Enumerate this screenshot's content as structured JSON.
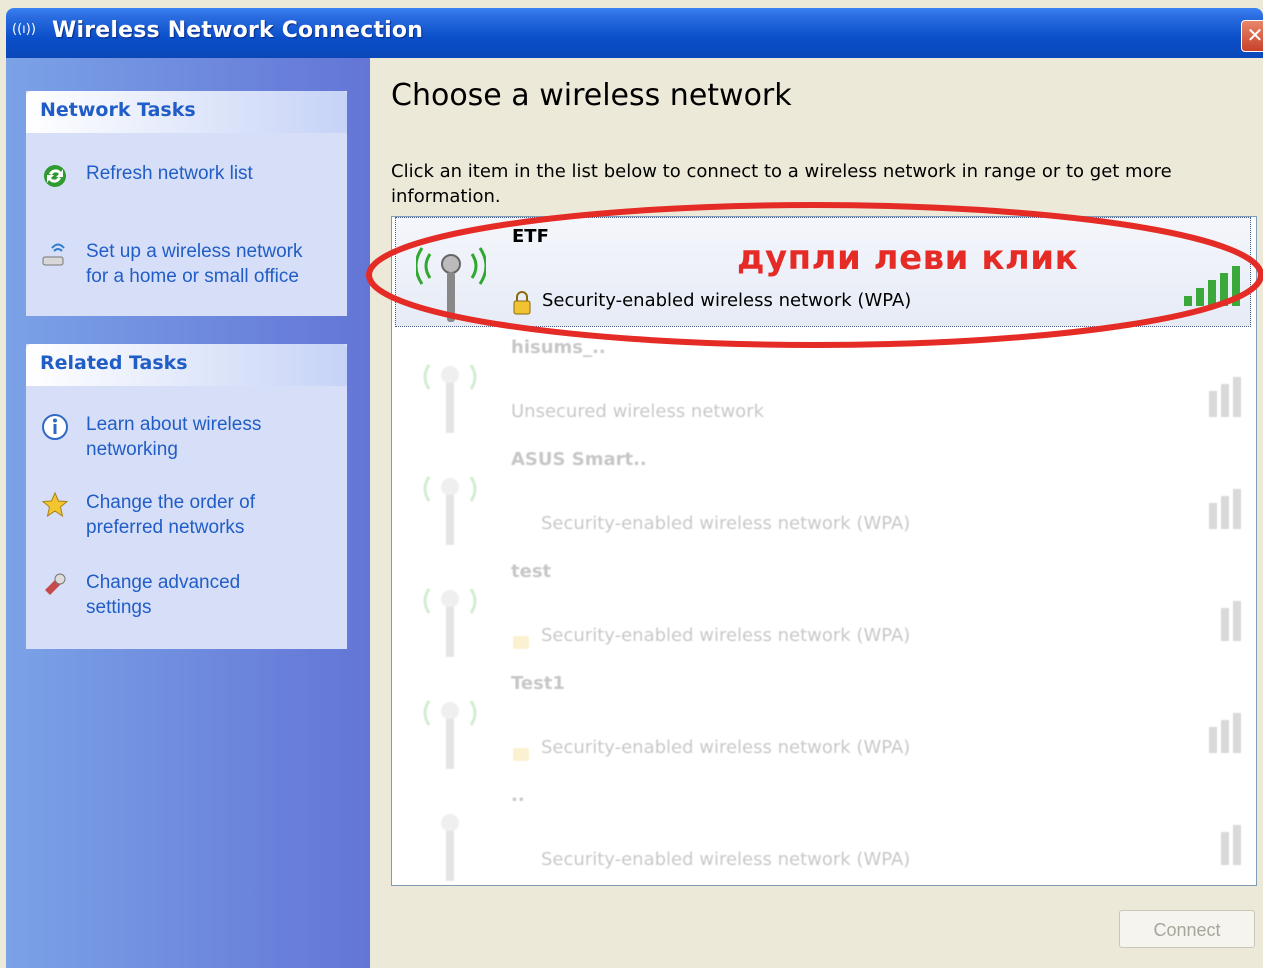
{
  "window": {
    "title": "Wireless Network Connection",
    "title_icon_glyph": "((ı))"
  },
  "sidebar": {
    "network_tasks": {
      "header": "Network Tasks",
      "items": [
        {
          "label": "Refresh network list",
          "icon": "refresh-icon"
        },
        {
          "label": "Set up a wireless network\nfor a home or small office",
          "icon": "wireless-setup-icon"
        }
      ]
    },
    "related_tasks": {
      "header": "Related Tasks",
      "items": [
        {
          "label": "Learn about wireless\nnetworking",
          "icon": "info-icon"
        },
        {
          "label": "Change the order of\npreferred networks",
          "icon": "star-icon"
        },
        {
          "label": "Change advanced\nsettings",
          "icon": "settings-icon"
        }
      ]
    }
  },
  "main": {
    "title": "Choose a wireless network",
    "instruction": "Click an item in the list below to connect to a wireless network in range or to get more information.",
    "networks": [
      {
        "name": "ETF",
        "security": "Security-enabled wireless network (WPA)",
        "selected": true
      },
      {
        "name": "hisums_..",
        "security": "Unsecured wireless network",
        "selected": false
      },
      {
        "name": "ASUS Smart..",
        "security": "Security-enabled wireless network (WPA)",
        "selected": false
      },
      {
        "name": "test",
        "security": "Security-enabled wireless network (WPA)",
        "selected": false
      },
      {
        "name": "Test1",
        "security": "Security-enabled wireless network (WPA)",
        "selected": false
      },
      {
        "name": "..",
        "security": "Security-enabled wireless network (WPA)",
        "selected": false
      }
    ],
    "connect_label": "Connect"
  },
  "annotation": {
    "text": "дупли леви клик",
    "color": "#e52b25"
  },
  "colors": {
    "titlebar": "#0a4fc9",
    "sidebar_link": "#215dc6",
    "signal_green": "#3aa83a"
  }
}
